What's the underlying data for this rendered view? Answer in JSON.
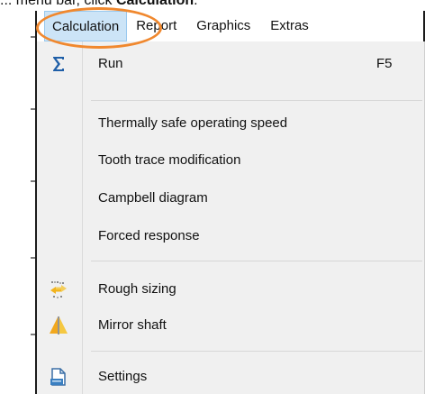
{
  "instruction": {
    "prefix": "... menu bar, click ",
    "target": "Calculation",
    "suffix": "."
  },
  "menubar": {
    "items": [
      {
        "label": "Calculation",
        "active": true
      },
      {
        "label": "Report"
      },
      {
        "label": "Graphics"
      },
      {
        "label": "Extras"
      }
    ]
  },
  "dropdown": {
    "items": [
      {
        "label": "Run",
        "shortcut": "F5",
        "icon": "sigma-icon"
      },
      {
        "label": "Thermally safe operating speed"
      },
      {
        "label": "Tooth trace modification"
      },
      {
        "label": "Campbell diagram"
      },
      {
        "label": "Forced response"
      },
      {
        "label": "Rough sizing",
        "icon": "rough-sizing-icon"
      },
      {
        "label": "Mirror shaft",
        "icon": "mirror-shaft-icon"
      },
      {
        "label": "Settings",
        "icon": "settings-icon"
      }
    ]
  },
  "colors": {
    "highlight_oval": "#f0882e",
    "active_menu_bg": "#cce4f7",
    "menu_bg": "#f0f0f0",
    "sigma_blue": "#1f5fa8"
  }
}
